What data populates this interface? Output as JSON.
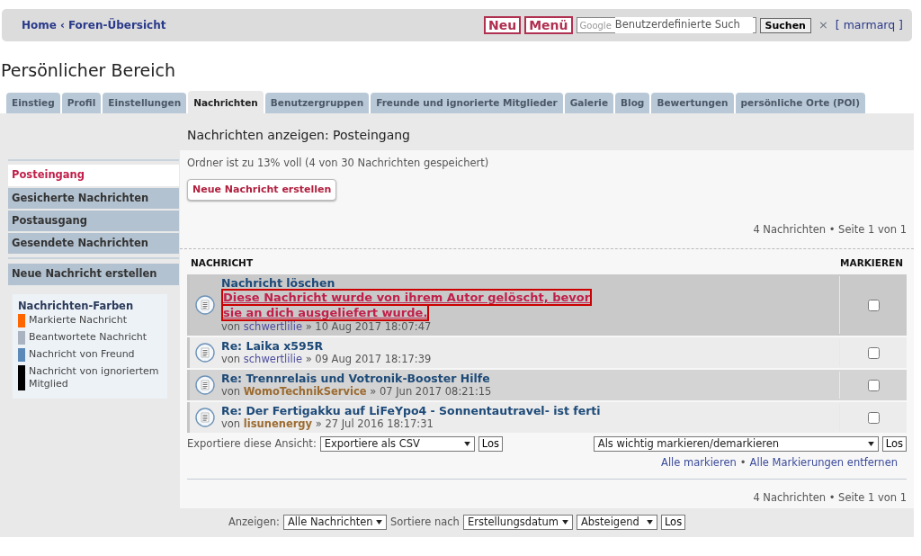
{
  "topbar": {
    "breadcrumbs": [
      {
        "label": "Home"
      },
      {
        "label": "Foren-Übersicht"
      }
    ],
    "separator": "‹",
    "buttons": [
      "Neu",
      "Menü"
    ],
    "search": {
      "brand": "Google",
      "placeholder": "Benutzerdefinierte Such"
    },
    "search_button": "Suchen",
    "clear": "×",
    "user": "[ marmarq ]"
  },
  "page_title": "Persönlicher Bereich",
  "tabs": [
    {
      "label": "Einstieg",
      "selected": false
    },
    {
      "label": "Profil",
      "selected": false
    },
    {
      "label": "Einstellungen",
      "selected": false
    },
    {
      "label": "Nachrichten",
      "selected": true
    },
    {
      "label": "Benutzergruppen",
      "selected": false
    },
    {
      "label": "Freunde und ignorierte Mitglieder",
      "selected": false
    },
    {
      "label": "Galerie",
      "selected": false
    },
    {
      "label": "Blog",
      "selected": false
    },
    {
      "label": "Bewertungen",
      "selected": false
    },
    {
      "label": "persönliche Orte (POI)",
      "selected": false
    }
  ],
  "sidebar": {
    "items": [
      {
        "label": "Posteingang",
        "selected": true
      },
      {
        "label": "Gesicherte Nachrichten",
        "selected": false
      },
      {
        "label": "Postausgang",
        "selected": false
      },
      {
        "label": "Gesendete Nachrichten",
        "selected": false
      }
    ],
    "compose": "Neue Nachricht erstellen",
    "legend": {
      "title": "Nachrichten-Farben",
      "items": [
        {
          "label": "Markierte Nachricht",
          "color": "#ff6600"
        },
        {
          "label": "Beantwortete Nachricht",
          "color": "#aab4c1"
        },
        {
          "label": "Nachricht von Freund",
          "color": "#5c8ab8"
        },
        {
          "label": "Nachricht von ignoriertem Mitglied",
          "color": "#000000"
        }
      ]
    }
  },
  "main": {
    "heading": "Nachrichten anzeigen: Posteingang",
    "quota": "Ordner ist zu 13% voll (4 von 30 Nachrichten gespeichert)",
    "new_button": "Neue Nachricht erstellen",
    "pagination_top": "4 Nachrichten • Seite 1 von 1",
    "columns": [
      "NACHRICHT",
      "MARKIEREN"
    ],
    "rows": [
      {
        "title": "Nachricht löschen",
        "notice": "Diese Nachricht wurde von ihrem Autor gelöscht, bevor sie an dich ausgeliefert wurde.",
        "by": "von",
        "author": "schwertlilie",
        "color": "#4d4d9e",
        "date": "» 10 Aug 2017 18:07:47",
        "checked": false
      },
      {
        "title": "Re: Laika x595R",
        "by": "von",
        "author": "schwertlilie",
        "color": "#4d4d9e",
        "date": "» 09 Aug 2017 18:17:39",
        "checked": false
      },
      {
        "title": "Re: Trennrelais und Votronik-Booster Hilfe",
        "by": "von",
        "author": "WomoTechnikService",
        "color": "#9c6b30",
        "date": "» 07 Jun 2017 08:21:15",
        "checked": false
      },
      {
        "title": "Re: Der Fertigakku auf LiFeYpo4 - Sonnentautravel- ist ferti",
        "by": "von",
        "author": "lisunenergy",
        "color": "#9c6b30",
        "date": "» 27 Jul 2016 18:17:31",
        "checked": false
      }
    ],
    "export_label": "Exportiere diese Ansicht:",
    "export_select": "Exportiere als CSV",
    "go_export": "Los",
    "go_mark": "Los",
    "mark_select": "Als wichtig markieren/demarkieren",
    "mark_all": "Alle markieren",
    "bullet": "•",
    "unmark_all": "Alle Markierungen entfernen",
    "pagination_bottom": "4 Nachrichten • Seite 1 von 1"
  },
  "footer": {
    "show_label": "Anzeigen:",
    "show_select": "Alle Nachrichten",
    "sort_label": "Sortiere nach",
    "sort_select": "Erstellungsdatum",
    "order_select": "Absteigend",
    "go": "Los"
  }
}
